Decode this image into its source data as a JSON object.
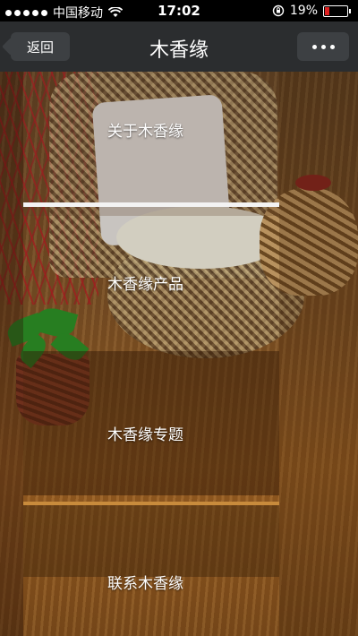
{
  "status_bar": {
    "carrier": "中国移动",
    "time": "17:02",
    "battery_percent": "19%",
    "battery_level": 0.19,
    "battery_color": "#e02020"
  },
  "nav": {
    "back_label": "返回",
    "title": "木香缘"
  },
  "menu": {
    "items": [
      {
        "label": "关于木香缘"
      },
      {
        "label": "木香缘产品"
      },
      {
        "label": "木香缘专题"
      },
      {
        "label": "联系木香缘"
      }
    ]
  },
  "icons": [
    "signal-dots-icon",
    "wifi-icon",
    "rotation-lock-icon",
    "battery-icon",
    "back-arrow-icon",
    "more-icon"
  ]
}
